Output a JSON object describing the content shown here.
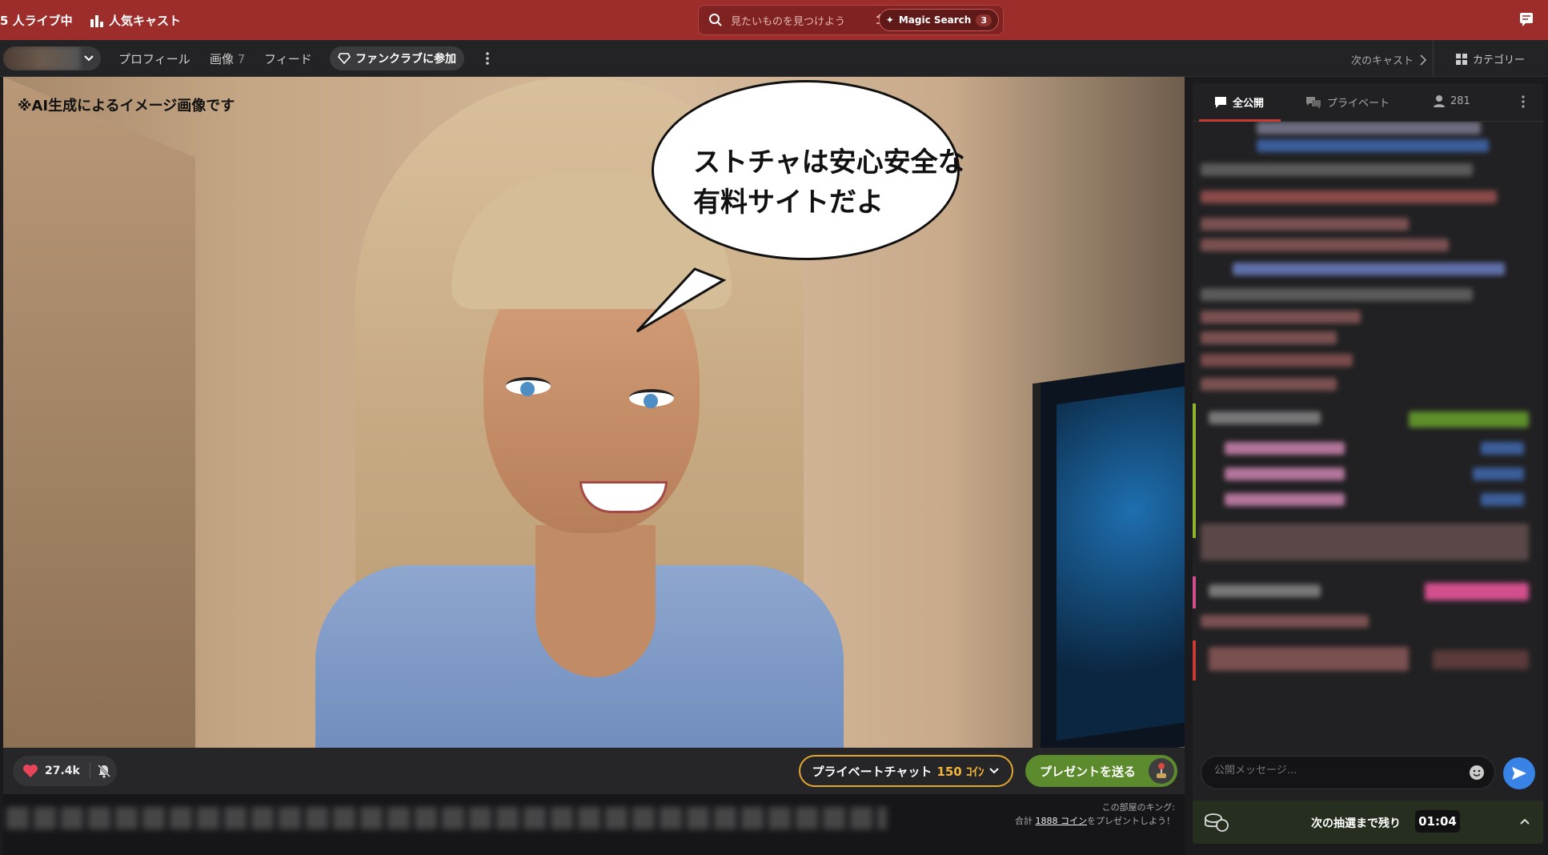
{
  "topbar": {
    "live_count_label": "5 人ライブ中",
    "popular_label": "人気キャスト",
    "search_placeholder": "見たいものを見つけよう",
    "magic_label": "Magic Search",
    "magic_count": "3"
  },
  "subbar": {
    "profile": "プロフィール",
    "images": "画像",
    "images_count": "7",
    "feed": "フィード",
    "fanclub": "ファンクラブに参加",
    "next_cast": "次のキャスト",
    "category": "カテゴリー"
  },
  "video": {
    "ai_note": "※AI生成によるイメージ画像です",
    "bubble_text": "ストチャは安心安全な\n有料サイトだよ"
  },
  "video_bar": {
    "likes": "27.4k",
    "private_label": "プライベートチャット",
    "private_price": "150 ｺｲﾝ",
    "gift_label": "プレゼントを送る"
  },
  "below": {
    "king_line1": "この部屋のキング:",
    "king_prefix": "合計",
    "king_amount": "1888 コイン",
    "king_suffix": "をプレゼントしよう！"
  },
  "chat": {
    "tabs": [
      {
        "label": "全公開"
      },
      {
        "label": "プライベート"
      },
      {
        "label": "281"
      }
    ],
    "input_placeholder": "公開メッセージ...",
    "lottery_label": "次の抽選まで残り",
    "lottery_timer": "01:04"
  },
  "colors": {
    "topbar": "#9c2d2b",
    "accent_red": "#c83b35",
    "gold": "#e0a730",
    "green": "#5b8b2d",
    "send_blue": "#3a83e6"
  }
}
